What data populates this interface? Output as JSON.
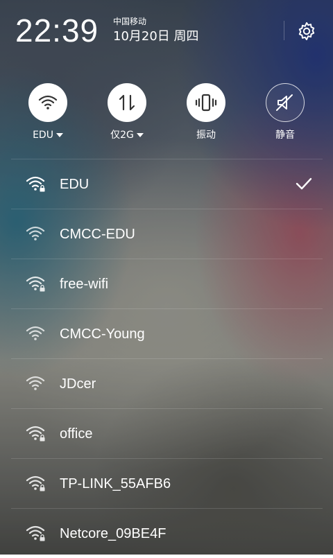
{
  "status": {
    "time": "22:39",
    "carrier": "中国移动",
    "date": "10月20日 周四"
  },
  "toggles": [
    {
      "label": "EDU",
      "icon": "wifi-icon",
      "active": true,
      "dropdown": true
    },
    {
      "label": "仅2G",
      "icon": "data-transfer-icon",
      "active": true,
      "dropdown": true
    },
    {
      "label": "振动",
      "icon": "vibrate-icon",
      "active": true,
      "dropdown": false
    },
    {
      "label": "静音",
      "icon": "mute-icon",
      "active": false,
      "dropdown": false
    }
  ],
  "wifi_list": [
    {
      "ssid": "EDU",
      "locked": true,
      "connected": true
    },
    {
      "ssid": "CMCC-EDU",
      "locked": false,
      "connected": false
    },
    {
      "ssid": "free-wifi",
      "locked": true,
      "connected": false
    },
    {
      "ssid": "CMCC-Young",
      "locked": false,
      "connected": false
    },
    {
      "ssid": "JDcer",
      "locked": false,
      "connected": false
    },
    {
      "ssid": "office",
      "locked": true,
      "connected": false
    },
    {
      "ssid": "TP-LINK_55AFB6",
      "locked": true,
      "connected": false
    },
    {
      "ssid": "Netcore_09BE4F",
      "locked": true,
      "connected": false
    }
  ],
  "colors": {
    "toggle_on_bg": "#ffffff",
    "toggle_icon": "#333333",
    "text": "#ffffff"
  }
}
